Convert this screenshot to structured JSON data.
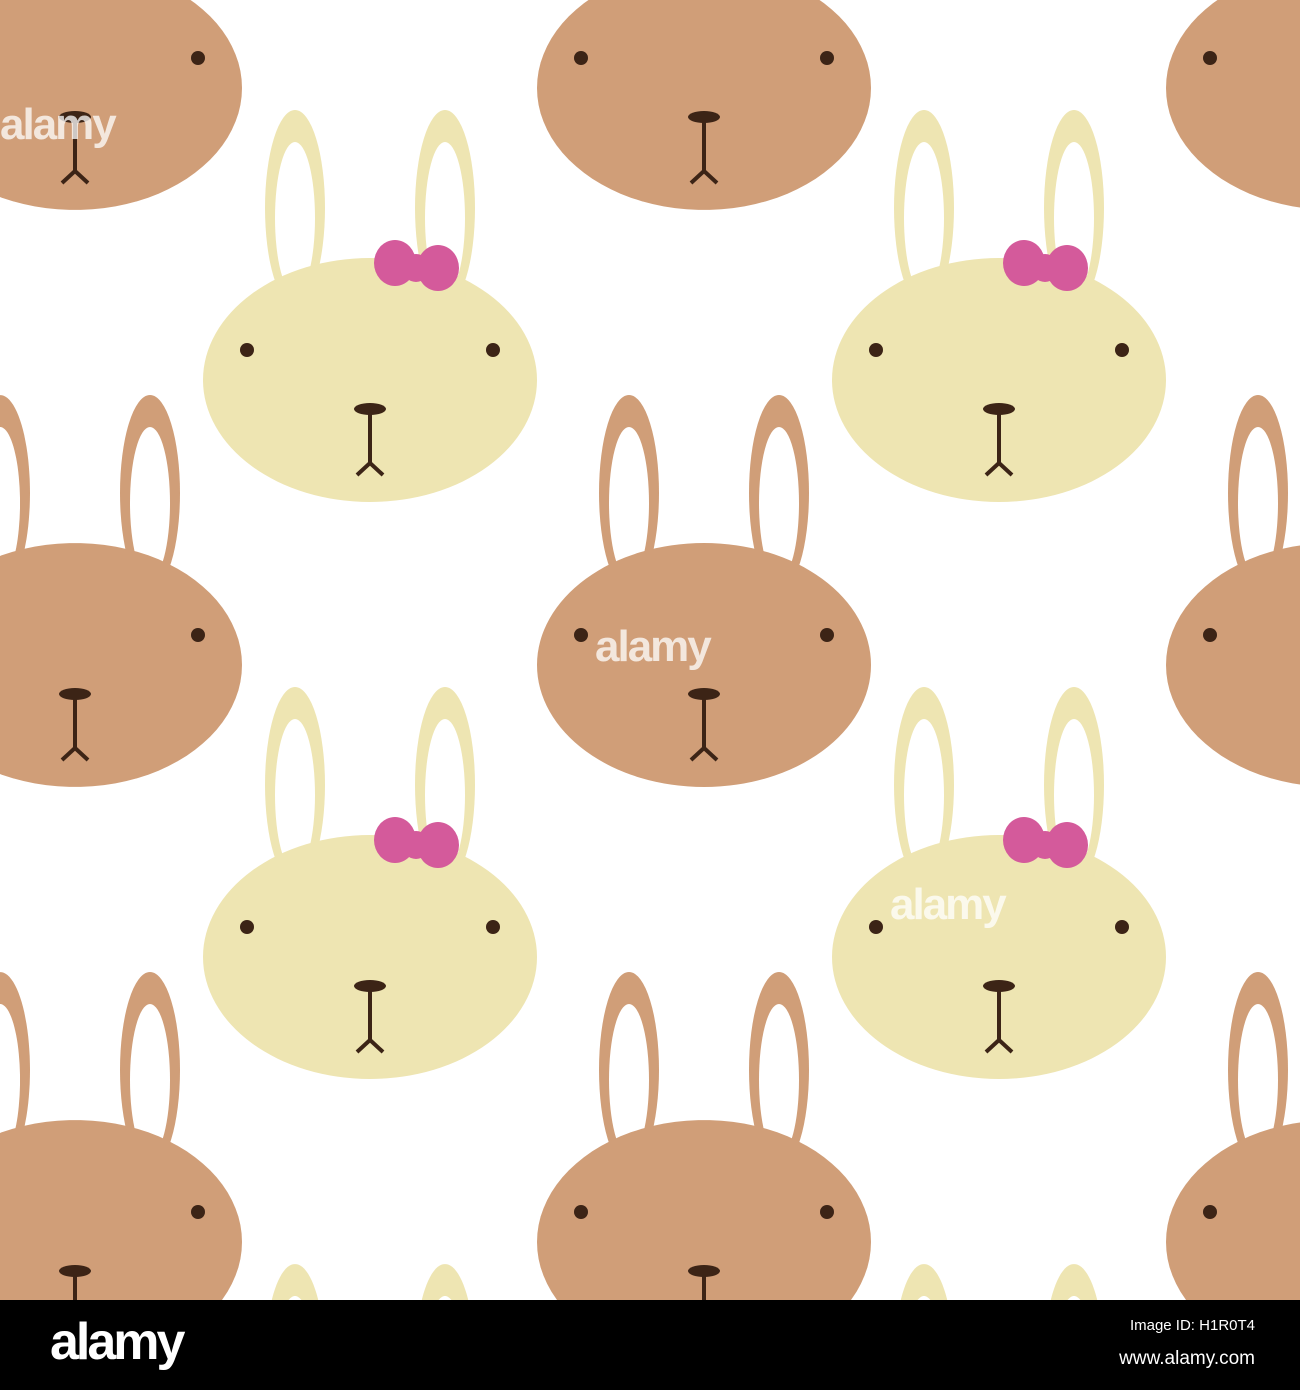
{
  "colors": {
    "background": "#ffffff",
    "brown_bunny": "#d09e78",
    "cream_bunny": "#eee5b2",
    "bow": "#d45a9b",
    "features": "#3c2416"
  },
  "watermark": {
    "text": "alamy"
  },
  "footer": {
    "logo": "alamy",
    "image_id": "Image ID: H1R0T4",
    "url": "www.alamy.com"
  }
}
